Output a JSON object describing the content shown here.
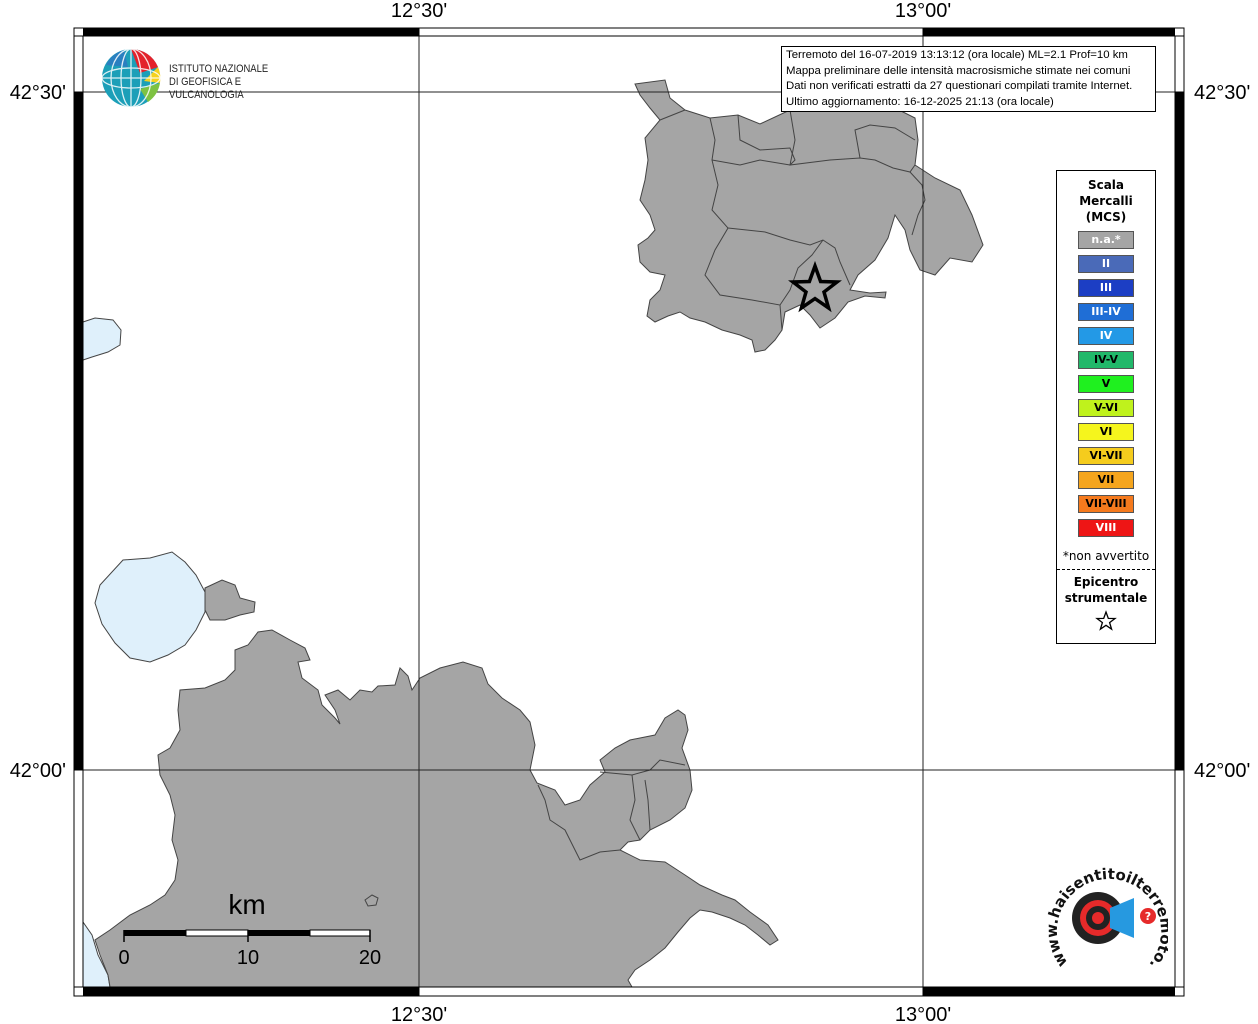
{
  "map": {
    "lat_labels": [
      "42°30'",
      "42°00'"
    ],
    "lon_labels": [
      "12°30'",
      "13°00'"
    ],
    "land_color": "#a5a5a5",
    "water_color": "#dff0fb",
    "border_color": "#000000"
  },
  "info_box": {
    "line1": "Terremoto del 16-07-2019 13:13:12 (ora locale) ML=2.1 Prof=10 km",
    "line2": "Mappa preliminare delle intensità macrosismiche stimate nei comuni",
    "line3": "Dati non verificati estratti da 27 questionari compilati tramite Internet.",
    "line4": "Ultimo aggiornamento: 16-12-2025 21:13 (ora locale)"
  },
  "logo_ingv": {
    "line1": "ISTITUTO NAZIONALE",
    "line2": "DI GEOFISICA E VULCANOLOGIA"
  },
  "legend": {
    "title_line1": "Scala",
    "title_line2": "Mercalli",
    "title_line3": "(MCS)",
    "items": [
      {
        "label": "n.a.*",
        "color": "#a5a5a5",
        "text_color": "#ffffff"
      },
      {
        "label": "II",
        "color": "#4a6ab8",
        "text_color": "#ffffff"
      },
      {
        "label": "III",
        "color": "#1c3ec4",
        "text_color": "#ffffff"
      },
      {
        "label": "III-IV",
        "color": "#1f6ed6",
        "text_color": "#ffffff"
      },
      {
        "label": "IV",
        "color": "#2399e6",
        "text_color": "#ffffff"
      },
      {
        "label": "IV-V",
        "color": "#21b86a",
        "text_color": "#000000"
      },
      {
        "label": "V",
        "color": "#1ff01f",
        "text_color": "#000000"
      },
      {
        "label": "V-VI",
        "color": "#bff21c",
        "text_color": "#000000"
      },
      {
        "label": "VI",
        "color": "#f5f51d",
        "text_color": "#000000"
      },
      {
        "label": "VI-VII",
        "color": "#f5cc1d",
        "text_color": "#000000"
      },
      {
        "label": "VII",
        "color": "#f5a51d",
        "text_color": "#000000"
      },
      {
        "label": "VII-VIII",
        "color": "#f57a1d",
        "text_color": "#000000"
      },
      {
        "label": "VIII",
        "color": "#ee1515",
        "text_color": "#ffffff"
      }
    ],
    "note": "*non avvertito",
    "epicenter_line1": "Epicentro",
    "epicenter_line2": "strumentale"
  },
  "scale_bar": {
    "unit": "km",
    "labels": [
      "0",
      "10",
      "20"
    ]
  },
  "logo_hsit": {
    "text": "www.haisentitoilterremoto.it",
    "help_mark": "?"
  }
}
